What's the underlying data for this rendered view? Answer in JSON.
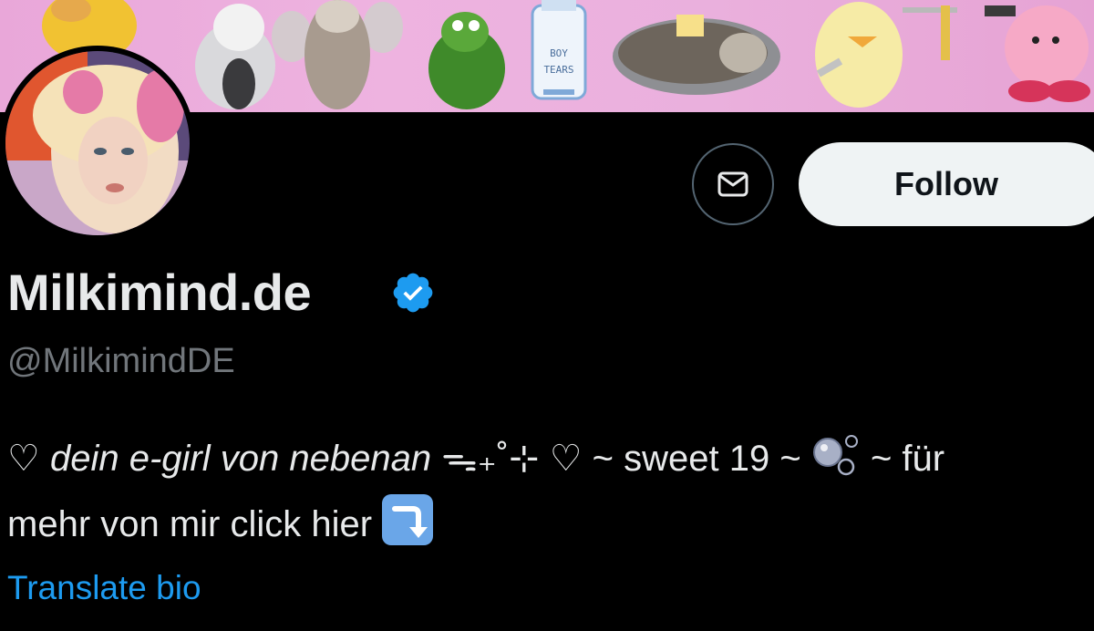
{
  "banner": {
    "label": "BOY TEARS"
  },
  "profile": {
    "display_name": "Milkimind.de",
    "handle": "@MilkimindDE",
    "verified_icon": "verified-badge-icon",
    "accent_color": "#1d9bf0"
  },
  "actions": {
    "message_icon": "envelope-icon",
    "follow_label": "Follow"
  },
  "bio": {
    "line1_heart_start": "♡ ",
    "line1_italic": "dein e-girl von nebenan",
    "line1_symbols": " ᯓ₊˚⊹ ♡ ~ sweet 19 ~ ",
    "line1_end": " ~ für",
    "line2_text": "mehr von mir click hier ",
    "bubbles_icon": "bubbles-emoji",
    "arrow_icon": "arrow-down-right-emoji"
  },
  "translate": {
    "label": "Translate bio"
  }
}
